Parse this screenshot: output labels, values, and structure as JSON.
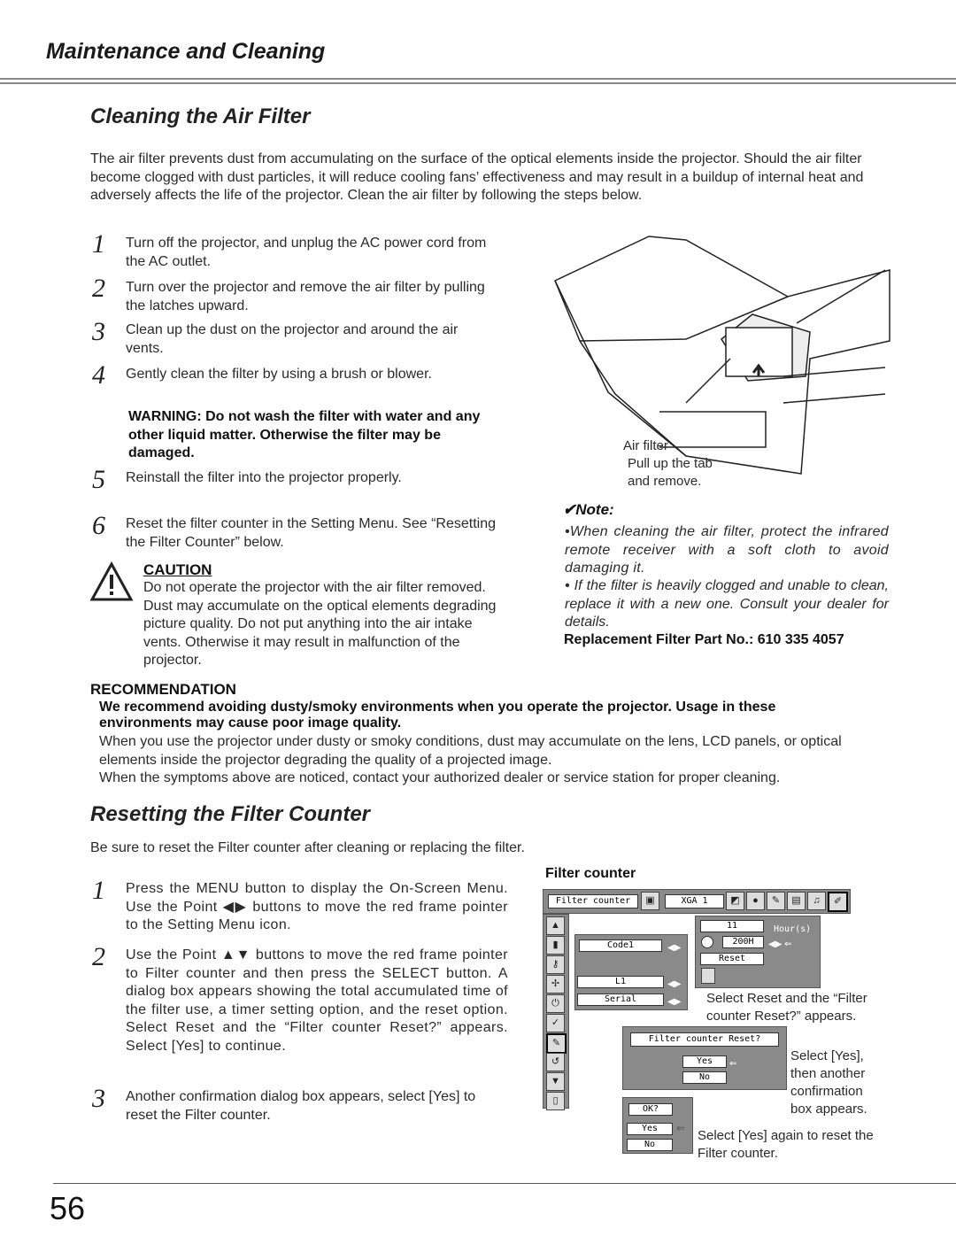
{
  "header": {
    "title": "Maintenance and Cleaning"
  },
  "air": {
    "title": "Cleaning the Air Filter",
    "intro": "The air filter prevents dust from accumulating on the surface of the optical elements inside the projector. Should the air filter become clogged with dust particles, it will reduce cooling fans’ effectiveness and may result in a buildup of internal heat and adversely affects the life of the projector. Clean the air filter by following the steps below.",
    "steps": [
      {
        "n": "1",
        "text": "Turn off the projector, and unplug the AC power cord from the AC outlet."
      },
      {
        "n": "2",
        "text": "Turn over the projector and remove the air filter by pulling the latches upward."
      },
      {
        "n": "3",
        "text": "Clean up the dust on the projector and around the air vents."
      },
      {
        "n": "4",
        "text": "Gently clean the filter by using a brush or blower."
      },
      {
        "n": "5",
        "text": "Reinstall the filter into the projector properly."
      },
      {
        "n": "6",
        "text": "Reset the filter counter in the Setting Menu. See “Resetting the Filter Counter” below."
      }
    ],
    "warning": "WARNING: Do not wash the filter with water and any other liquid matter. Otherwise the filter may be damaged.",
    "caution_title": "CAUTION",
    "caution_text": "Do not operate the projector with the air filter removed. Dust may accumulate on the optical elements degrading picture quality. Do not put anything into the air intake vents. Otherwise it may result in malfunction of the projector.",
    "fig_label1": "Air filter",
    "fig_label2": "Pull up the tab",
    "fig_label3": "and remove.",
    "note_title": "✔Note:",
    "note1": "•When cleaning the air filter, protect the infrared remote receiver with a soft cloth to avoid damaging it.",
    "note2": "• If the filter is heavily clogged and unable to clean, replace it with a new one. Consult your dealer for details.",
    "part": "Replacement Filter Part No.: 610 335 4057"
  },
  "recommendation": {
    "title": "RECOMMENDATION",
    "bold": "We recommend avoiding dusty/smoky environments when you operate the projector. Usage in these environments may cause poor image quality.",
    "p1": "When you use the projector under dusty or smoky conditions, dust may accumulate on the lens, LCD panels, or optical elements inside the projector degrading the quality of a projected image.",
    "p2": "When the symptoms above are noticed, contact your authorized dealer or service station for proper cleaning."
  },
  "reset": {
    "title": "Resetting the Filter Counter",
    "intro": "Be sure to reset the Filter counter after cleaning or replacing the filter.",
    "steps": [
      {
        "n": "1",
        "text": "Press the MENU button to display the On-Screen Menu. Use the Point ◀▶ buttons to move the red frame pointer to the Setting Menu icon."
      },
      {
        "n": "2",
        "text": "Use the Point ▲▼ buttons to move the red frame pointer to Filter counter and then press the SELECT button. A dialog box appears showing the total accumulated time of the filter use, a timer setting option, and the reset option. Select Reset and the “Filter counter Reset?” appears. Select [Yes] to continue."
      },
      {
        "n": "3",
        "text": "Another confirmation dialog box appears, select [Yes] to reset the Filter counter."
      }
    ],
    "fig_title": "Filter counter",
    "menu": {
      "bar_label": "Filter counter",
      "input": "XGA 1",
      "code": "Code1",
      "l1": "L1",
      "serial": "Serial",
      "hours": "11",
      "hours_unit": "Hour(s)",
      "timer": "200H",
      "reset": "Reset",
      "confirm": "Filter counter Reset?",
      "yes": "Yes",
      "no": "No",
      "ok": "OK?"
    },
    "cap1": "Select Reset and the “Filter counter Reset?” appears.",
    "cap2": "Select [Yes], then another confirmation box appears.",
    "cap3": "Select [Yes] again to reset the Filter counter."
  },
  "page_number": "56"
}
